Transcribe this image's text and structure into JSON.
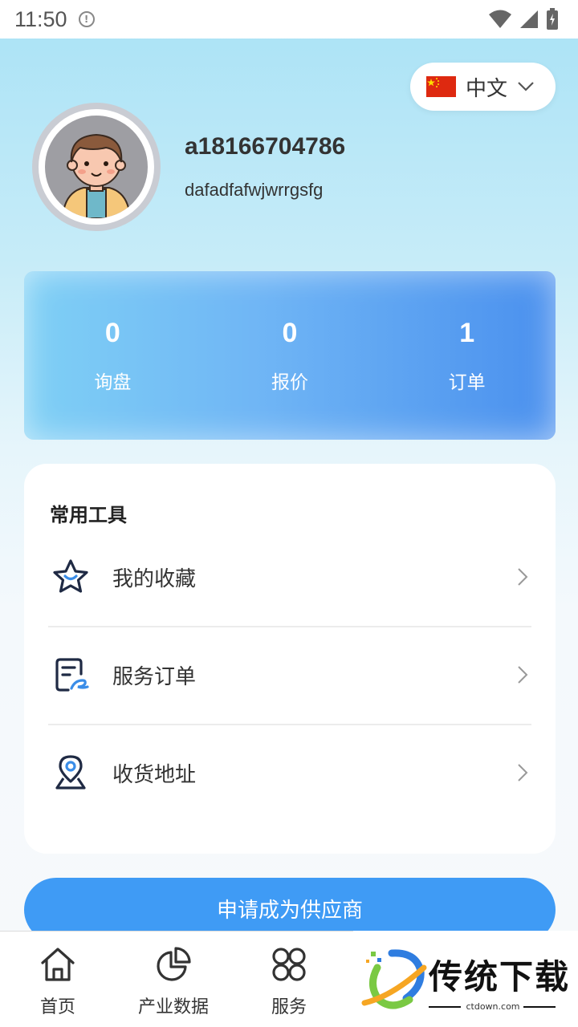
{
  "status_bar": {
    "time": "11:50"
  },
  "language": {
    "label": "中文",
    "flag": "china-flag"
  },
  "profile": {
    "username": "a18166704786",
    "subtitle": "dafadfafwjwrrgsfg"
  },
  "stats": [
    {
      "value": "0",
      "label": "询盘"
    },
    {
      "value": "0",
      "label": "报价"
    },
    {
      "value": "1",
      "label": "订单"
    }
  ],
  "tools": {
    "title": "常用工具",
    "items": [
      {
        "label": "我的收藏",
        "icon": "star-icon"
      },
      {
        "label": "服务订单",
        "icon": "order-icon"
      },
      {
        "label": "收货地址",
        "icon": "location-icon"
      }
    ]
  },
  "apply_button": "申请成为供应商",
  "nav": [
    {
      "label": "首页",
      "icon": "home-icon"
    },
    {
      "label": "产业数据",
      "icon": "pie-chart-icon"
    },
    {
      "label": "服务",
      "icon": "services-icon"
    }
  ],
  "watermark": {
    "text": "传统下载",
    "url": "ctdown.com"
  },
  "colors": {
    "accent": "#3f9bf5",
    "stats_start": "#7fd0f5",
    "stats_end": "#4a90ee",
    "icon_accent": "#3a8de8",
    "icon_dark": "#1f2a44"
  }
}
